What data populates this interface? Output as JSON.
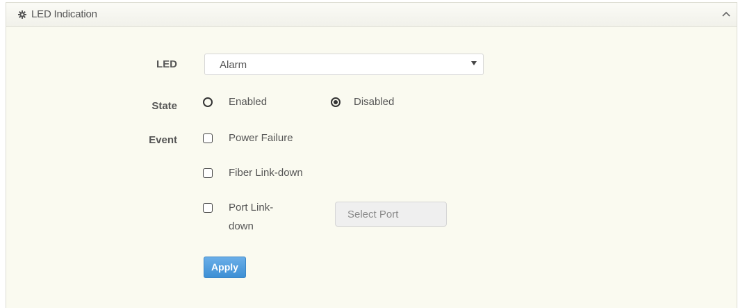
{
  "panel": {
    "title": "LED Indication",
    "icon": "gear-icon",
    "collapse_icon": "chevron-up-icon"
  },
  "form": {
    "led": {
      "label": "LED",
      "selected": "Alarm"
    },
    "state": {
      "label": "State",
      "options": [
        {
          "label": "Enabled",
          "selected": false
        },
        {
          "label": "Disabled",
          "selected": true
        }
      ]
    },
    "event": {
      "label": "Event",
      "options": [
        {
          "label": "Power Failure",
          "checked": false
        },
        {
          "label": "Fiber Link-down",
          "checked": false
        },
        {
          "label_line1": "Port Link-",
          "label_line2": "down",
          "checked": false
        }
      ],
      "port_placeholder": "Select Port"
    },
    "apply_label": "Apply"
  },
  "colors": {
    "panel_background": "#fafaf0",
    "apply_button": "#4a9ae0"
  }
}
